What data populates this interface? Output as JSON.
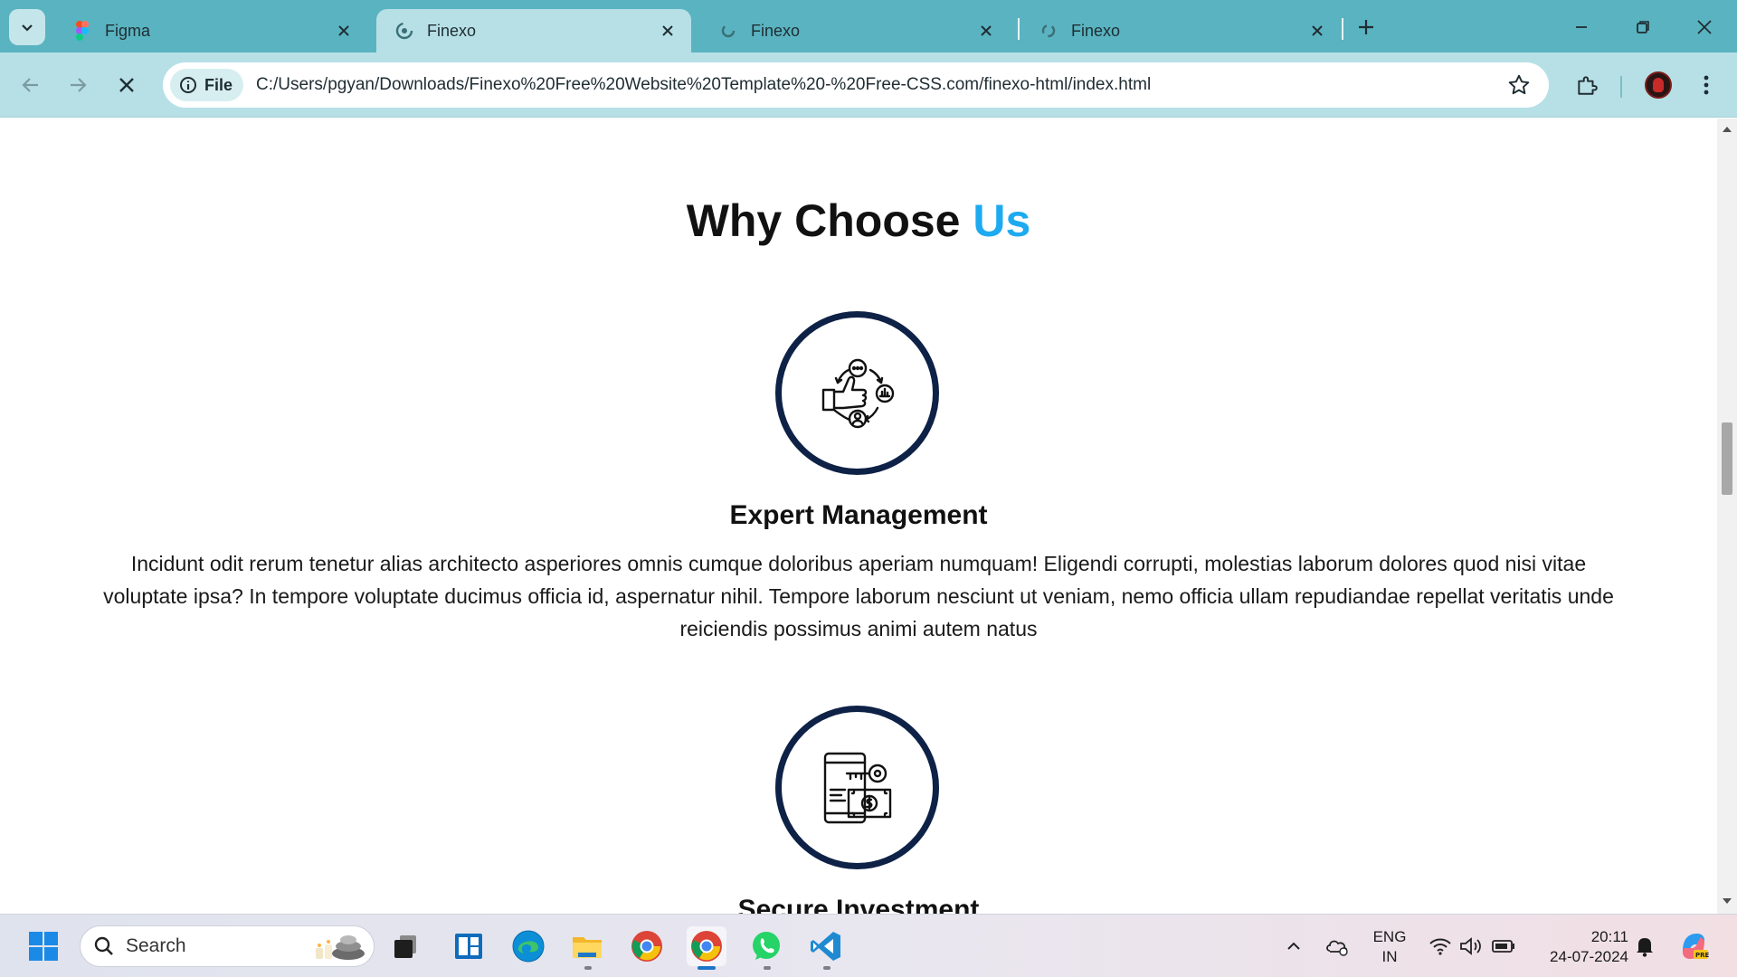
{
  "browser": {
    "tabs": [
      {
        "title": "Figma",
        "active": false
      },
      {
        "title": "Finexo",
        "active": true
      },
      {
        "title": "Finexo",
        "active": false
      },
      {
        "title": "Finexo",
        "active": false
      }
    ],
    "address": {
      "chip_label": "File",
      "url": "C:/Users/pgyan/Downloads/Finexo%20Free%20Website%20Template%20-%20Free-CSS.com/finexo-html/index.html"
    }
  },
  "page": {
    "heading_main": "Why Choose ",
    "heading_accent": "Us",
    "features": [
      {
        "icon": "thumbs-up-cycle-icon",
        "title": "Expert Management",
        "text": "Incidunt odit rerum tenetur alias architecto asperiores omnis cumque doloribus aperiam numquam! Eligendi corrupti, molestias laborum dolores quod nisi vitae voluptate ipsa? In tempore voluptate ducimus officia id, aspernatur nihil. Tempore laborum nesciunt ut veniam, nemo officia ullam repudiandae repellat veritatis unde reiciendis possimus animi autem natus"
      },
      {
        "icon": "secure-investment-icon",
        "title": "Secure Investment"
      }
    ]
  },
  "taskbar": {
    "search_label": "Search",
    "lang_top": "ENG",
    "lang_bottom": "IN",
    "time": "20:11",
    "date": "24-07-2024"
  },
  "colors": {
    "accent": "#1eaaf1",
    "circle_border": "#0e2146",
    "tabstrip": "#5ab3c0",
    "toolbar": "#b6e0e6"
  }
}
